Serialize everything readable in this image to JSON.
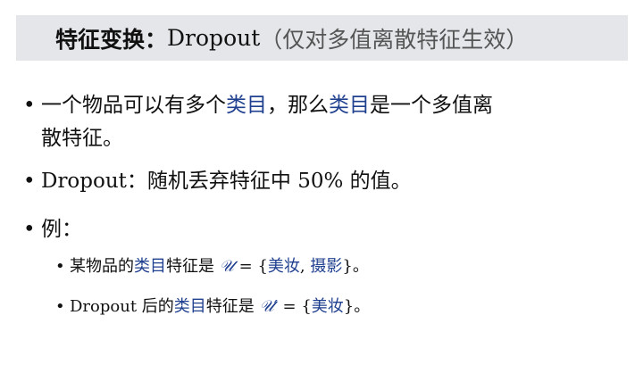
{
  "title": {
    "bold": "特征变换：",
    "main": "Dropout",
    "sub": "（仅对多值离散特征生效）"
  },
  "bullets": {
    "b1_part1": "一个物品可以有多个",
    "b1_hl1": "类目",
    "b1_part2": "，那么",
    "b1_hl2": "类目",
    "b1_part3": "是一个多值离",
    "b1_line2": "散特征。",
    "b2": "Dropout：随机丢弃特征中 50% 的值。",
    "b3": "例：",
    "ex1_pre": "某物品的",
    "ex1_hl": "类目",
    "ex1_mid": "特征是",
    "ex1_math": "𝒰",
    "ex1_eq": " = {",
    "ex1_v1": "美妆",
    "ex1_comma": ", ",
    "ex1_v2": "摄影",
    "ex1_end": "}。",
    "ex2_pre": "Dropout 后的",
    "ex2_hl": "类目",
    "ex2_mid": "特征是",
    "ex2_math": "𝒰′",
    "ex2_eq": " = {",
    "ex2_v1": "美妆",
    "ex2_end": "}。"
  },
  "colors": {
    "highlight": "#1f3f8f",
    "title_bg": "#e4e6ea"
  }
}
